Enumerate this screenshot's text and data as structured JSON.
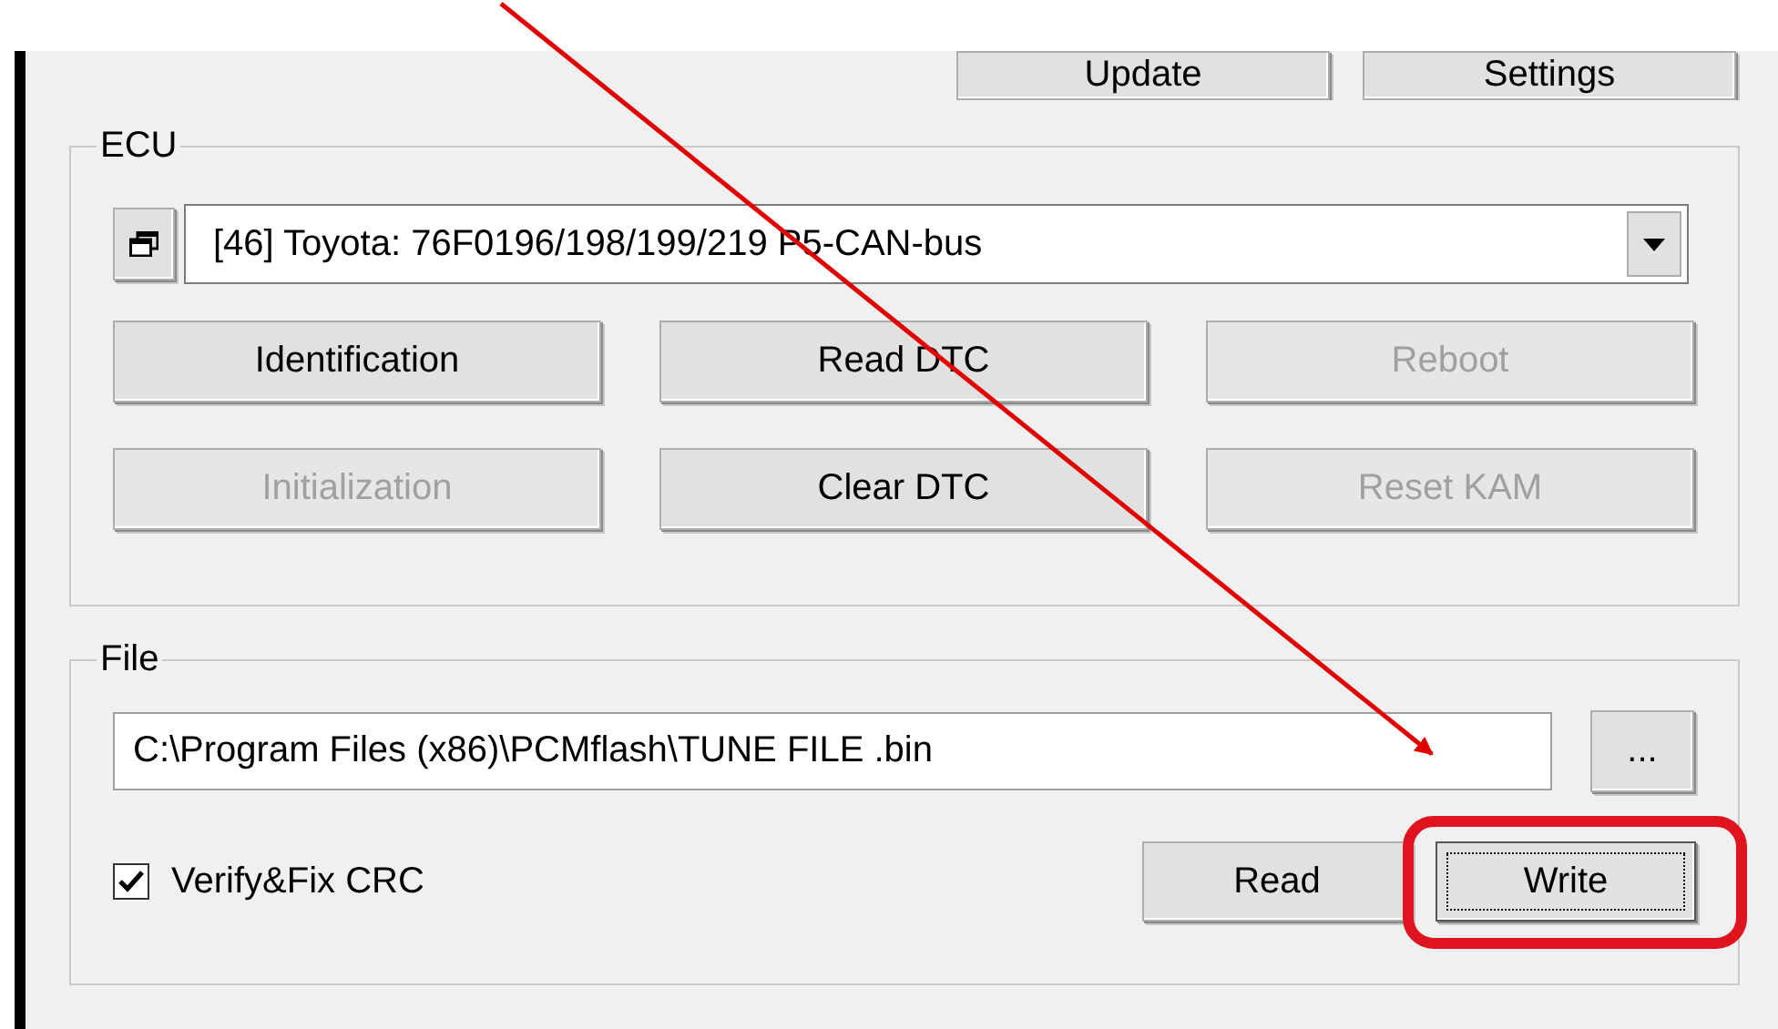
{
  "top_buttons": [
    {
      "label": "Update",
      "disabled": false
    },
    {
      "label": "Settings",
      "disabled": false
    }
  ],
  "ecu": {
    "title": "ECU",
    "selected_ecu": "[46] Toyota: 76F0196/198/199/219 P5-CAN-bus",
    "buttons": [
      {
        "label": "Identification",
        "disabled": false
      },
      {
        "label": "Read DTC",
        "disabled": false
      },
      {
        "label": "Reboot",
        "disabled": true
      },
      {
        "label": "Initialization",
        "disabled": true
      },
      {
        "label": "Clear DTC",
        "disabled": false
      },
      {
        "label": "Reset KAM",
        "disabled": true
      }
    ]
  },
  "file": {
    "title": "File",
    "path": "C:\\Program Files (x86)\\PCMflash\\TUNE FILE .bin",
    "browse_label": "...",
    "verify_crc": {
      "label": "Verify&Fix CRC",
      "checked": true
    },
    "buttons": [
      {
        "label": "Read",
        "focused": false
      },
      {
        "label": "Write",
        "focused": true
      }
    ]
  }
}
